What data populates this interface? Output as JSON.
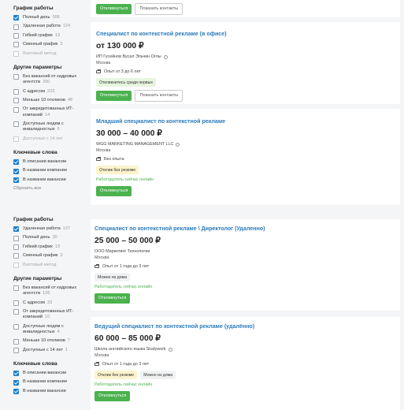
{
  "sidebar1": {
    "work_schedule_title": "График работы",
    "schedule": [
      {
        "label": "Полный день",
        "count": "306",
        "checked": true
      },
      {
        "label": "Удаленная работа",
        "count": "124",
        "checked": false
      },
      {
        "label": "Гибкий график",
        "count": "13",
        "checked": false
      },
      {
        "label": "Сменный график",
        "count": "3",
        "checked": false
      },
      {
        "label": "Вахтовый метод",
        "count": "",
        "checked": false
      }
    ],
    "other_title": "Другие параметры",
    "other": [
      {
        "label": "Без вакансий от кадровых агентств",
        "count": "290",
        "checked": false
      },
      {
        "label": "С адресом",
        "count": "223",
        "checked": false
      },
      {
        "label": "Меньше 10 откликов",
        "count": "48",
        "checked": false
      },
      {
        "label": "От аккредитованных ИТ-компаний",
        "count": "14",
        "checked": false
      },
      {
        "label": "Доступные людям с инвалидностью",
        "count": "6",
        "checked": false
      },
      {
        "label": "Доступные с 14 лет",
        "count": "",
        "checked": false
      }
    ],
    "keywords_title": "Ключевые слова",
    "keywords": [
      {
        "label": "В описании вакансии",
        "checked": true
      },
      {
        "label": "В названии компании",
        "checked": true
      },
      {
        "label": "В названии вакансии",
        "checked": true
      }
    ],
    "reset_label": "Сбросить все"
  },
  "sidebar2": {
    "work_schedule_title": "График работы",
    "schedule": [
      {
        "label": "Удаленная работа",
        "count": "137",
        "checked": true
      },
      {
        "label": "Полный день",
        "count": "30",
        "checked": false
      },
      {
        "label": "Гибкий график",
        "count": "13",
        "checked": false
      },
      {
        "label": "Сменный график",
        "count": "3",
        "checked": false
      },
      {
        "label": "Вахтовый метод",
        "count": "",
        "checked": false
      }
    ],
    "other_title": "Другие параметры",
    "other": [
      {
        "label": "Без вакансий от кадровых агентств",
        "count": "126",
        "checked": false
      },
      {
        "label": "С адресом",
        "count": "33",
        "checked": false
      },
      {
        "label": "От аккредитованных ИТ-компаний",
        "count": "10",
        "checked": false
      },
      {
        "label": "Доступные людям с инвалидностью",
        "count": "4",
        "checked": false
      },
      {
        "label": "Меньше 10 откликов",
        "count": "7",
        "checked": false
      },
      {
        "label": "Доступные с 14 лет",
        "count": "1",
        "checked": false
      }
    ],
    "keywords_title": "Ключевые слова",
    "keywords": [
      {
        "label": "В описании вакансии",
        "checked": true
      },
      {
        "label": "В названии компании",
        "checked": true
      },
      {
        "label": "В названии вакансии",
        "checked": true
      }
    ]
  },
  "card0": {
    "respond_label": "Откликнуться",
    "contacts_label": "Показать контакты"
  },
  "card1": {
    "title": "Специалист по контекстной рекламе (в офисе)",
    "salary": "от 130 000 ₽",
    "company": "ИП Гусейнов Вусал Эльчин Оглы",
    "city": "Москва",
    "experience": "Опыт от 3 до 6 лет",
    "tag": "Откликнитесь среди первых",
    "respond_label": "Откликнуться",
    "contacts_label": "Показать контакты"
  },
  "card2": {
    "title": "Младший специалист по контекстной рекламе",
    "salary": "30 000 – 40 000 ₽",
    "company": "WGG MARKETING MANAGEMENT LLC",
    "city": "Москва",
    "experience": "Без опыта",
    "tag": "Отклик без резюме",
    "online": "Работодатель сейчас онлайн",
    "respond_label": "Откликнуться"
  },
  "card3": {
    "title": "Специалист по контекстной рекламе \\ Директолог (Удаленно)",
    "salary": "25 000 – 50 000 ₽",
    "company": "ООО Маркетинг Технологии",
    "city": "Москва",
    "experience": "Опыт от 1 года до 3 лет",
    "tag": "Можно из дома",
    "online": "Работодатель сейчас онлайн",
    "respond_label": "Откликнуться"
  },
  "card4": {
    "title": "Ведущий специалист по контекстной рекламе (удалённо)",
    "salary": "60 000 – 85 000 ₽",
    "company": "Школа английского языка Studywork",
    "city": "Москва",
    "experience": "Опыт от 1 года до 3 лет",
    "tag1": "Отклик без резюме",
    "tag2": "Можно из дома",
    "online": "Работодатель сейчас онлайн",
    "respond_label": "Откликнуться"
  },
  "colors": {
    "accent": "#2b7bbd",
    "button": "#4bb24e",
    "checkbox": "#1a7fd1"
  }
}
